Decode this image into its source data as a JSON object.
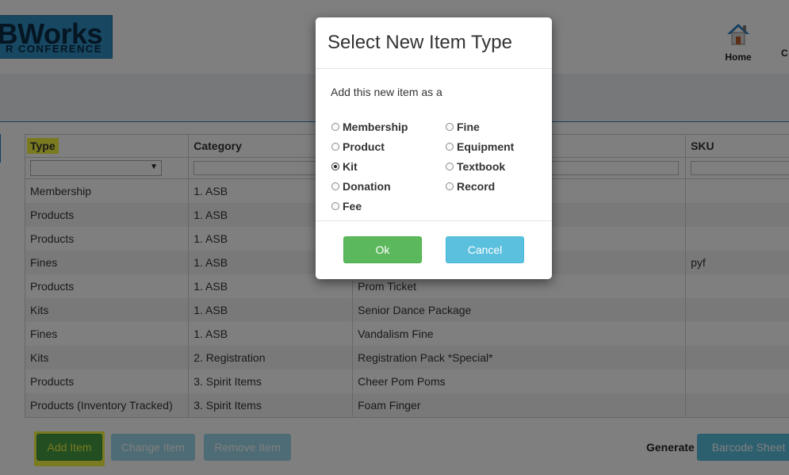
{
  "header": {
    "logo_top": "SBWorks",
    "logo_bottom": "R CONFERENCE",
    "nav": [
      {
        "label": "Home",
        "icon": "home-icon"
      },
      {
        "label": "C"
      }
    ]
  },
  "table": {
    "columns": [
      "Type",
      "Category",
      "SKU"
    ],
    "rows": [
      {
        "type": "Membership",
        "category": "1. ASB",
        "name": "",
        "sku": ""
      },
      {
        "type": "Products",
        "category": "1. ASB",
        "name": "",
        "sku": ""
      },
      {
        "type": "Products",
        "category": "1. ASB",
        "name": "",
        "sku": ""
      },
      {
        "type": "Fines",
        "category": "1. ASB",
        "name": "",
        "sku": "pyf"
      },
      {
        "type": "Products",
        "category": "1. ASB",
        "name": "Prom Ticket",
        "sku": ""
      },
      {
        "type": "Kits",
        "category": "1. ASB",
        "name": "Senior Dance Package",
        "sku": ""
      },
      {
        "type": "Fines",
        "category": "1. ASB",
        "name": "Vandalism Fine",
        "sku": ""
      },
      {
        "type": "Kits",
        "category": "2. Registration",
        "name": "Registration Pack *Special*",
        "sku": ""
      },
      {
        "type": "Products",
        "category": "3. Spirit Items",
        "name": "Cheer Pom Poms",
        "sku": ""
      },
      {
        "type": "Products (Inventory Tracked)",
        "category": "3. Spirit Items",
        "name": "Foam Finger",
        "sku": ""
      }
    ]
  },
  "buttons": {
    "add": "Add Item",
    "change": "Change Item",
    "remove": "Remove Item",
    "generate_label": "Generate",
    "barcode": "Barcode Sheet"
  },
  "modal": {
    "title": "Select New Item Type",
    "intro": "Add this new item as a",
    "options_left": [
      {
        "label": "Membership",
        "checked": false
      },
      {
        "label": "Product",
        "checked": false
      },
      {
        "label": "Kit",
        "checked": true
      },
      {
        "label": "Donation",
        "checked": false
      },
      {
        "label": "Fee",
        "checked": false
      }
    ],
    "options_right": [
      {
        "label": "Fine",
        "checked": false
      },
      {
        "label": "Equipment",
        "checked": false
      },
      {
        "label": "Textbook",
        "checked": false
      },
      {
        "label": "Record",
        "checked": false
      }
    ],
    "ok": "Ok",
    "cancel": "Cancel"
  },
  "colors": {
    "highlight": "#f5f542",
    "success": "#5cb85c",
    "info": "#5bc0de",
    "brand": "#2f8fc2"
  }
}
